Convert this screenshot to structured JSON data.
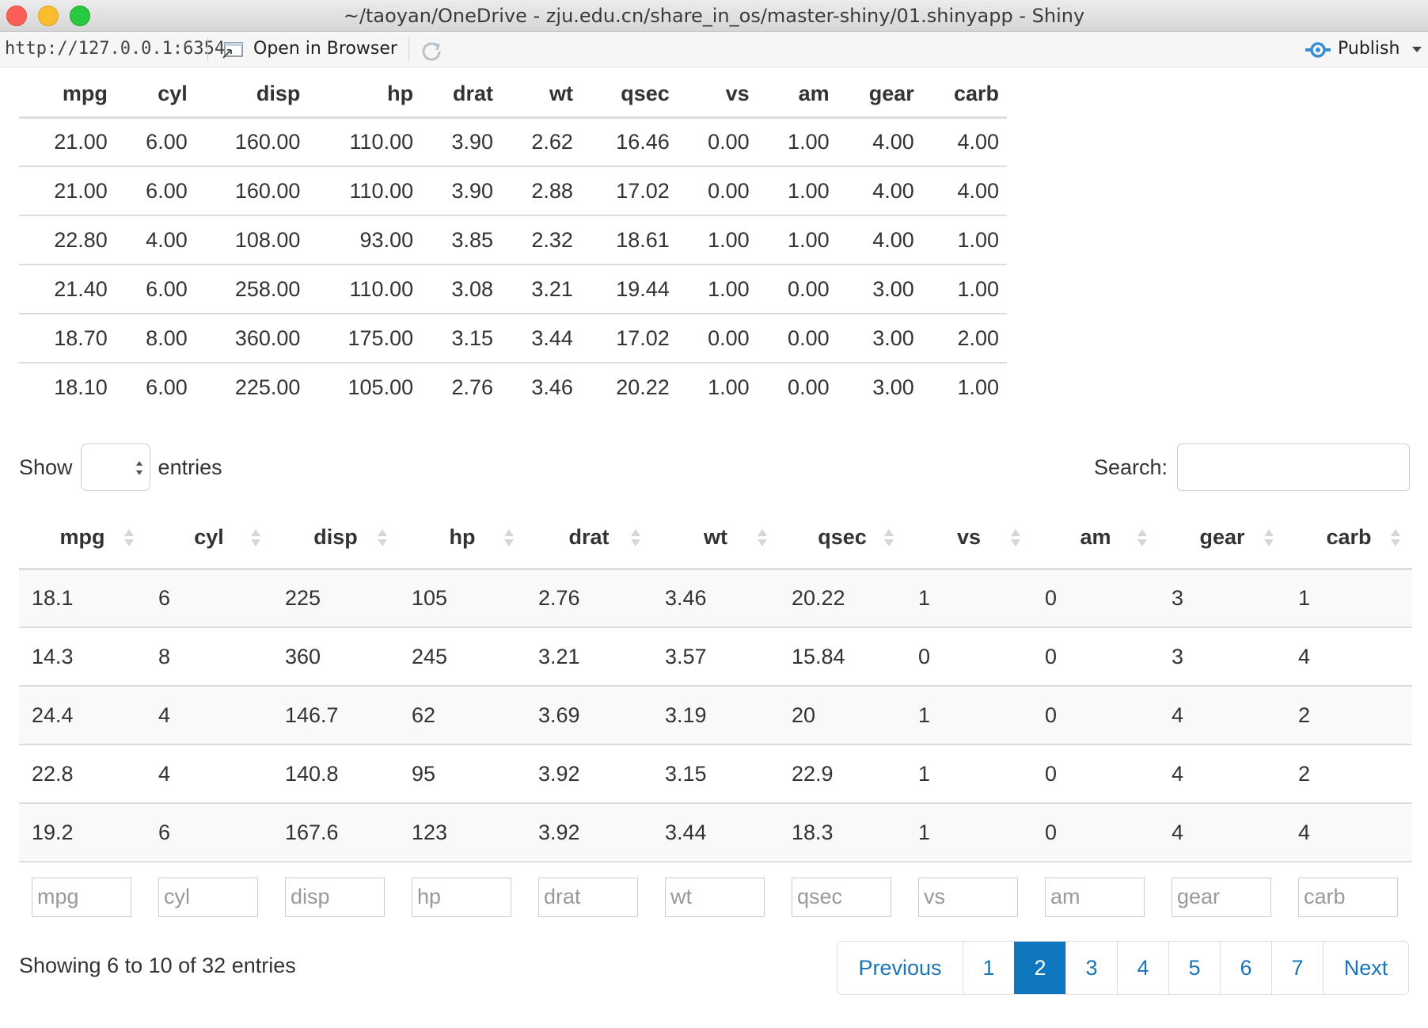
{
  "window": {
    "title": "~/taoyan/OneDrive - zju.edu.cn/share_in_os/master-shiny/01.shinyapp - Shiny"
  },
  "toolbar": {
    "url": "http://127.0.0.1:6354",
    "open_in_browser": "Open in Browser",
    "publish": "Publish"
  },
  "colors": {
    "accent": "#0f77bf",
    "link": "#1a74b8",
    "publish_icon": "#3a8fd3"
  },
  "static_table": {
    "columns": [
      "mpg",
      "cyl",
      "disp",
      "hp",
      "drat",
      "wt",
      "qsec",
      "vs",
      "am",
      "gear",
      "carb"
    ],
    "rows": [
      [
        "21.00",
        "6.00",
        "160.00",
        "110.00",
        "3.90",
        "2.62",
        "16.46",
        "0.00",
        "1.00",
        "4.00",
        "4.00"
      ],
      [
        "21.00",
        "6.00",
        "160.00",
        "110.00",
        "3.90",
        "2.88",
        "17.02",
        "0.00",
        "1.00",
        "4.00",
        "4.00"
      ],
      [
        "22.80",
        "4.00",
        "108.00",
        "93.00",
        "3.85",
        "2.32",
        "18.61",
        "1.00",
        "1.00",
        "4.00",
        "1.00"
      ],
      [
        "21.40",
        "6.00",
        "258.00",
        "110.00",
        "3.08",
        "3.21",
        "19.44",
        "1.00",
        "0.00",
        "3.00",
        "1.00"
      ],
      [
        "18.70",
        "8.00",
        "360.00",
        "175.00",
        "3.15",
        "3.44",
        "17.02",
        "0.00",
        "0.00",
        "3.00",
        "2.00"
      ],
      [
        "18.10",
        "6.00",
        "225.00",
        "105.00",
        "2.76",
        "3.46",
        "20.22",
        "1.00",
        "0.00",
        "3.00",
        "1.00"
      ]
    ]
  },
  "datatable": {
    "length": {
      "show_label": "Show",
      "entries_label": "entries",
      "value": ""
    },
    "search": {
      "label": "Search:",
      "value": ""
    },
    "columns": [
      "mpg",
      "cyl",
      "disp",
      "hp",
      "drat",
      "wt",
      "qsec",
      "vs",
      "am",
      "gear",
      "carb"
    ],
    "rows": [
      [
        "18.1",
        "6",
        "225",
        "105",
        "2.76",
        "3.46",
        "20.22",
        "1",
        "0",
        "3",
        "1"
      ],
      [
        "14.3",
        "8",
        "360",
        "245",
        "3.21",
        "3.57",
        "15.84",
        "0",
        "0",
        "3",
        "4"
      ],
      [
        "24.4",
        "4",
        "146.7",
        "62",
        "3.69",
        "3.19",
        "20",
        "1",
        "0",
        "4",
        "2"
      ],
      [
        "22.8",
        "4",
        "140.8",
        "95",
        "3.92",
        "3.15",
        "22.9",
        "1",
        "0",
        "4",
        "2"
      ],
      [
        "19.2",
        "6",
        "167.6",
        "123",
        "3.92",
        "3.44",
        "18.3",
        "1",
        "0",
        "4",
        "4"
      ]
    ],
    "filter_placeholders": [
      "mpg",
      "cyl",
      "disp",
      "hp",
      "drat",
      "wt",
      "qsec",
      "vs",
      "am",
      "gear",
      "carb"
    ],
    "info": "Showing 6 to 10 of 32 entries",
    "pagination": {
      "previous": "Previous",
      "next": "Next",
      "pages": [
        "1",
        "2",
        "3",
        "4",
        "5",
        "6",
        "7"
      ],
      "current": "2"
    }
  }
}
